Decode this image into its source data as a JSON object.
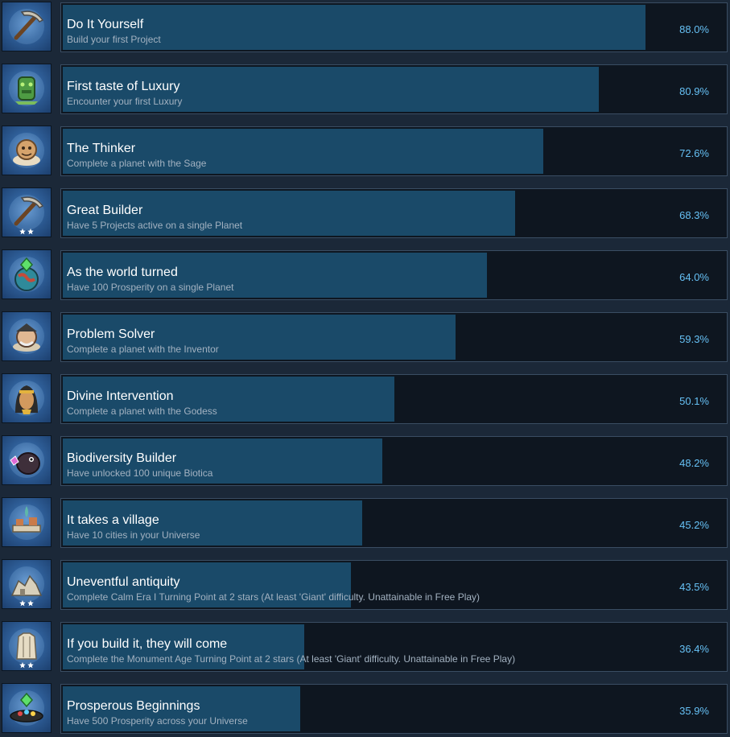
{
  "achievements": [
    {
      "title": "Do It Yourself",
      "description": "Build your first Project",
      "percent_label": "88.0%",
      "percent": 88.0,
      "icon": "pickaxe-icon",
      "stars": 0
    },
    {
      "title": "First taste of Luxury",
      "description": "Encounter your first Luxury",
      "percent_label": "80.9%",
      "percent": 80.9,
      "icon": "green-idol-icon",
      "stars": 0
    },
    {
      "title": "The Thinker",
      "description": "Complete a planet with the Sage",
      "percent_label": "72.6%",
      "percent": 72.6,
      "icon": "sage-icon",
      "stars": 0
    },
    {
      "title": "Great Builder",
      "description": "Have 5 Projects active on a single Planet",
      "percent_label": "68.3%",
      "percent": 68.3,
      "icon": "pickaxe-icon",
      "stars": 2
    },
    {
      "title": "As the world turned",
      "description": "Have 100 Prosperity on a single Planet",
      "percent_label": "64.0%",
      "percent": 64.0,
      "icon": "planet-gem-icon",
      "stars": 0
    },
    {
      "title": "Problem Solver",
      "description": "Complete a planet with the Inventor",
      "percent_label": "59.3%",
      "percent": 59.3,
      "icon": "inventor-icon",
      "stars": 0
    },
    {
      "title": "Divine Intervention",
      "description": "Complete a planet with the Godess",
      "percent_label": "50.1%",
      "percent": 50.1,
      "icon": "goddess-icon",
      "stars": 0
    },
    {
      "title": "Biodiversity Builder",
      "description": "Have unlocked 100 unique Biotica",
      "percent_label": "48.2%",
      "percent": 48.2,
      "icon": "creature-icon",
      "stars": 0
    },
    {
      "title": "It takes a village",
      "description": "Have 10 cities in your Universe",
      "percent_label": "45.2%",
      "percent": 45.2,
      "icon": "village-icon",
      "stars": 0
    },
    {
      "title": "Uneventful antiquity",
      "description": "Complete Calm Era I Turning Point at 2 stars (At least 'Giant' difficulty. Unattainable in Free Play)",
      "percent_label": "43.5%",
      "percent": 43.5,
      "icon": "ruins-icon",
      "stars": 2
    },
    {
      "title": "If you build it, they will come",
      "description": "Complete the Monument Age Turning Point at 2 stars (At least 'Giant' difficulty. Unattainable in Free Play)",
      "percent_label": "36.4%",
      "percent": 36.4,
      "icon": "monument-icon",
      "stars": 2
    },
    {
      "title": "Prosperous Beginnings",
      "description": "Have 500 Prosperity across your Universe",
      "percent_label": "35.9%",
      "percent": 35.9,
      "icon": "gem-platter-icon",
      "stars": 0
    }
  ]
}
